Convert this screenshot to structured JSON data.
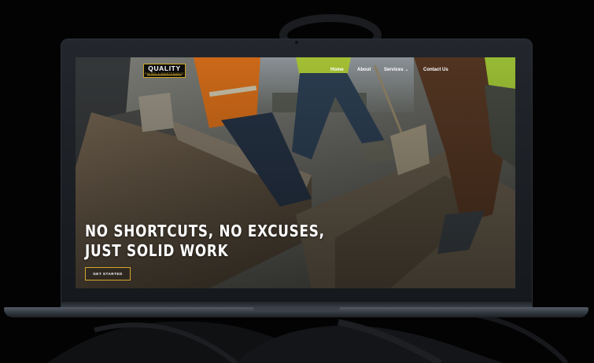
{
  "brand": {
    "logo_main": "QUALITY",
    "logo_sub": "PAVING & MAINTENANCE",
    "accent": "#c9a227"
  },
  "nav": {
    "items": [
      {
        "label": "Home"
      },
      {
        "label": "About"
      },
      {
        "label": "Services"
      },
      {
        "label": "Contact Us"
      }
    ]
  },
  "hero": {
    "headline_line1": "NO SHORTCUTS, NO EXCUSES,",
    "headline_line2": "JUST SOLID WORK",
    "cta_label": "GET STARTED"
  },
  "colors": {
    "page_background": "#030304",
    "laptop_frame": "#1c2024",
    "cta_border": "#d4a72c",
    "text": "#ffffff"
  }
}
